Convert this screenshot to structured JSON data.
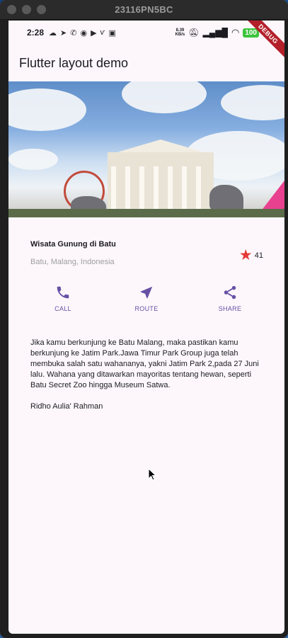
{
  "window": {
    "title": "23116PN5BC"
  },
  "statusbar": {
    "time": "2:28",
    "icons": [
      "cloud-icon",
      "telegram-icon",
      "whatsapp-icon",
      "circle-icon",
      "youtube-icon",
      "v-icon",
      "bag-icon"
    ],
    "net_speed_value": "8.39",
    "net_speed_unit": "KB/s",
    "battery": "100",
    "debug_label": "DEBUG"
  },
  "appbar": {
    "title": "Flutter layout demo"
  },
  "place": {
    "title": "Wisata Gunung di Batu",
    "location": "Batu, Malang, Indonesia",
    "rating_count": "41"
  },
  "actions": [
    {
      "label": "CALL",
      "icon": "phone-icon"
    },
    {
      "label": "ROUTE",
      "icon": "navigation-icon"
    },
    {
      "label": "SHARE",
      "icon": "share-icon"
    }
  ],
  "description": "Jika kamu berkunjung ke Batu Malang, maka pastikan kamu berkunjung ke Jatim Park.Jawa Timur Park Group juga telah membuka salah satu wahananya, yakni Jatim Park 2,pada 27 Juni lalu. Wahana yang ditawarkan mayoritas tentang hewan, seperti Batu Secret Zoo hingga Museum Satwa.\n\nRidho Aulia' Rahman",
  "colors": {
    "accent": "#6750a4",
    "star": "#e53935",
    "background": "#fdf7fc"
  }
}
